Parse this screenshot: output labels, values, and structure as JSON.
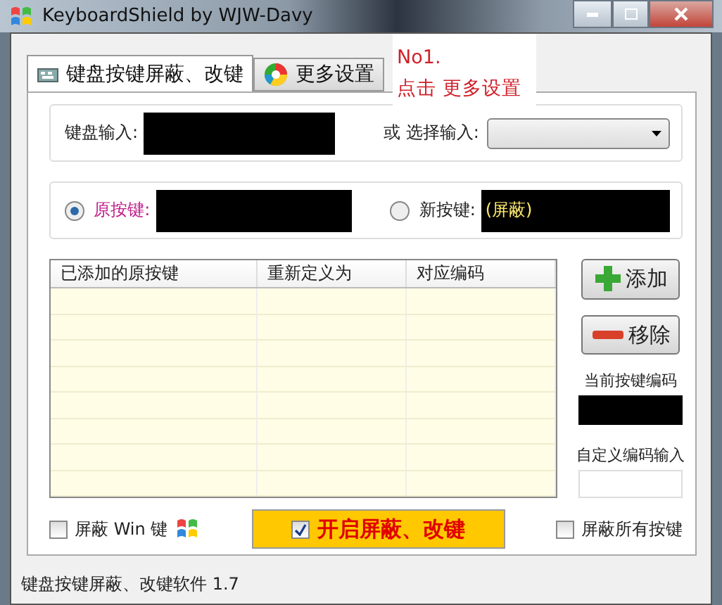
{
  "window": {
    "title": "KeyboardShield by WJW-Davy"
  },
  "tabs": [
    {
      "label": "键盘按键屏蔽、改键",
      "selected": true
    },
    {
      "label": "更多设置",
      "selected": false
    }
  ],
  "annotation": {
    "lines": [
      "No1.",
      "点击 更多设置"
    ]
  },
  "input_group": {
    "keyboard_label": "键盘输入:",
    "select_label": "或 选择输入:"
  },
  "key_group": {
    "options": [
      {
        "label": "原按键:",
        "selected": true
      },
      {
        "label": "新按键:",
        "selected": false,
        "value": "(屏蔽)"
      }
    ]
  },
  "table": {
    "columns": [
      "已添加的原按键",
      "重新定义为",
      "对应编码"
    ]
  },
  "buttons": [
    {
      "label": "添加",
      "kind": "add"
    },
    {
      "label": "移除",
      "kind": "remove"
    }
  ],
  "current_code": {
    "label": "当前按键编码"
  },
  "custom_code": {
    "label": "自定义编码输入"
  },
  "options": [
    {
      "label": "屏蔽 Win 键",
      "checked": false,
      "kind": "win"
    },
    {
      "label": "开启屏蔽、改键",
      "checked": true,
      "kind": "main"
    },
    {
      "label": "屏蔽所有按键",
      "checked": false,
      "kind": "plain"
    }
  ],
  "status_bar": {
    "text": "键盘按键屏蔽、改键软件 1.7"
  }
}
